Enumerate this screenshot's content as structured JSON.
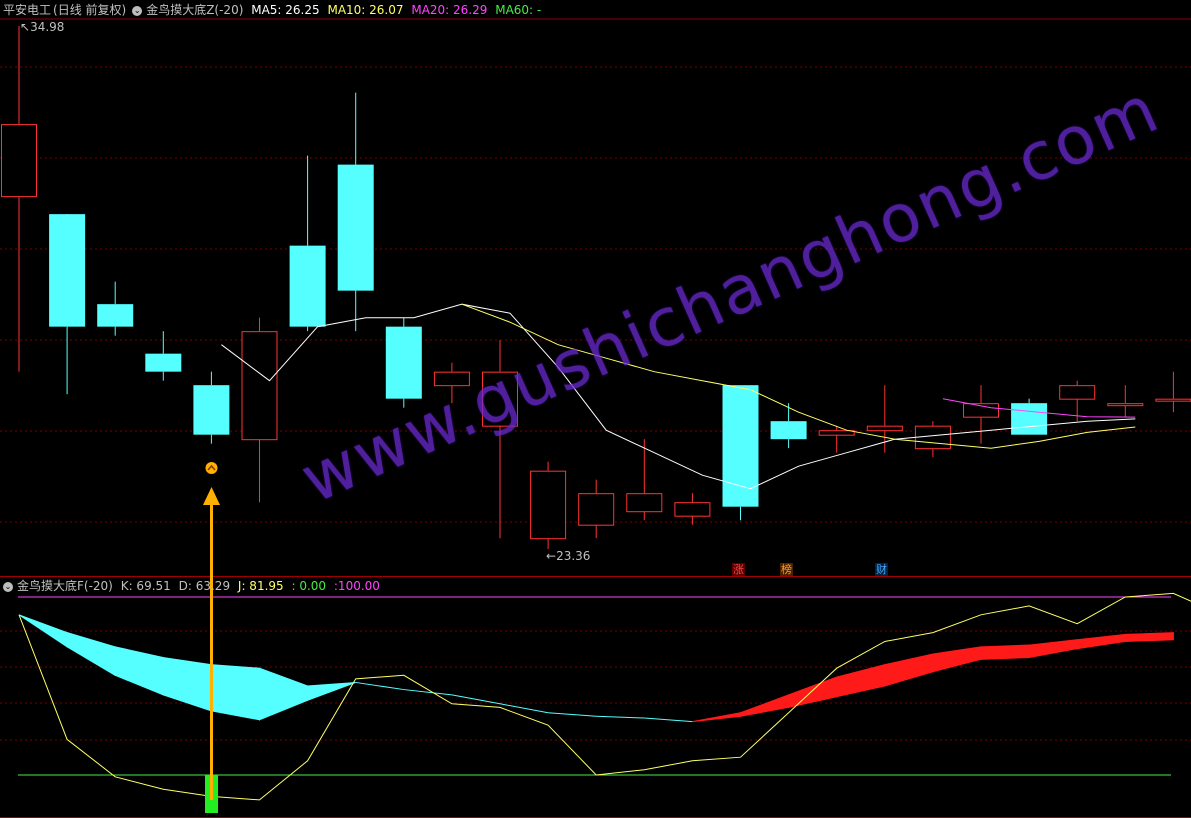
{
  "main_panel": {
    "stock": "平安电工",
    "period": "(日线 前复权)",
    "indicator": "金鸟摸大底Z(-20)",
    "ma": [
      {
        "label": "MA5: 26.25",
        "color": "#ffffff"
      },
      {
        "label": "MA10: 26.07",
        "color": "#ffff66"
      },
      {
        "label": "MA20: 26.29",
        "color": "#ff44ff"
      },
      {
        "label": "MA60: -",
        "color": "#44ee44"
      }
    ],
    "high_label": "34.98",
    "low_label": "23.36",
    "badges": [
      {
        "text": "涨",
        "color": "#ff4444",
        "bg": "#5a0000"
      },
      {
        "text": "榜",
        "color": "#ff9a30",
        "bg": "#4a2200"
      },
      {
        "text": "财",
        "color": "#44aaff",
        "bg": "#002244"
      }
    ]
  },
  "sub_panel": {
    "indicator": "金鸟摸大底F(-20)",
    "values": [
      {
        "label": "K: 69.51",
        "color": "#c0c0c0"
      },
      {
        "label": "D: 63.29",
        "color": "#c0c0c0"
      },
      {
        "label": "J: 81.95",
        "color": "#ffff66"
      },
      {
        "label": ": 0.00",
        "color": "#44ee44"
      },
      {
        "label": ":100.00",
        "color": "#ff44ff"
      }
    ]
  },
  "watermark": "www.gushichanghong.com",
  "colors": {
    "up": "#ff3333",
    "down": "#55ffff",
    "grid": "#7a0000",
    "ma5": "#ffffff",
    "ma10": "#ffff66",
    "ma20": "#ff44ff",
    "zero_line": "#44ee44",
    "hundred_line": "#ff44ff",
    "arrow": "#ffb000"
  },
  "chart_data": [
    {
      "type": "candlestick",
      "series": [
        {
          "name": "MA5",
          "values": [
            null,
            null,
            null,
            null,
            27.9,
            27.1,
            28.3,
            28.5,
            28.5,
            28.8,
            28.6,
            27.4,
            26.0,
            25.5,
            25.0,
            24.7,
            25.2,
            25.5,
            25.8,
            25.9,
            26.0,
            26.1,
            26.2,
            26.25
          ]
        },
        {
          "name": "MA10",
          "values": [
            null,
            null,
            null,
            null,
            null,
            null,
            null,
            null,
            null,
            28.8,
            28.4,
            27.9,
            27.6,
            27.3,
            27.1,
            26.9,
            26.4,
            26.0,
            25.8,
            25.7,
            25.6,
            25.75,
            25.95,
            26.07
          ]
        },
        {
          "name": "MA20",
          "values": [
            null,
            null,
            null,
            null,
            null,
            null,
            null,
            null,
            null,
            null,
            null,
            null,
            null,
            null,
            null,
            null,
            null,
            null,
            null,
            26.7,
            26.5,
            26.4,
            26.3,
            26.29
          ]
        }
      ],
      "ohlc": [
        [
          31.2,
          34.98,
          27.3,
          32.8
        ],
        [
          30.8,
          29.4,
          26.8,
          28.3
        ],
        [
          28.8,
          29.3,
          28.1,
          28.3
        ],
        [
          27.7,
          28.2,
          27.1,
          27.3
        ],
        [
          27.0,
          27.3,
          25.7,
          25.9
        ],
        [
          25.8,
          28.5,
          24.4,
          28.2
        ],
        [
          30.1,
          32.1,
          28.2,
          28.3
        ],
        [
          31.9,
          33.5,
          28.2,
          29.1
        ],
        [
          28.3,
          28.5,
          26.5,
          26.7
        ],
        [
          27.0,
          27.5,
          26.6,
          27.3
        ],
        [
          26.1,
          28.0,
          23.6,
          27.3
        ],
        [
          23.6,
          25.3,
          23.36,
          25.1
        ],
        [
          23.9,
          24.9,
          23.6,
          24.6
        ],
        [
          24.2,
          25.8,
          24.0,
          24.6
        ],
        [
          24.1,
          24.6,
          23.9,
          24.4
        ],
        [
          27.0,
          27.0,
          24.0,
          24.3
        ],
        [
          26.2,
          26.6,
          25.6,
          25.8
        ],
        [
          25.9,
          26.1,
          25.5,
          26.0
        ],
        [
          26.0,
          27.0,
          25.5,
          26.1
        ],
        [
          25.6,
          26.2,
          25.4,
          26.1
        ],
        [
          26.3,
          27.0,
          25.7,
          26.6
        ],
        [
          26.6,
          26.7,
          25.9,
          25.9
        ],
        [
          26.7,
          27.1,
          26.2,
          27.0
        ],
        [
          26.6,
          27.0,
          26.3,
          26.6
        ],
        [
          26.7,
          27.3,
          26.4,
          26.7
        ]
      ]
    },
    {
      "type": "area",
      "series": [
        {
          "name": "K",
          "values": [
            90,
            72,
            56,
            45,
            36,
            31,
            42,
            52,
            48,
            45,
            40,
            35,
            33,
            32,
            30,
            35,
            45,
            55,
            62,
            68,
            72,
            73,
            76,
            79,
            80
          ]
        },
        {
          "name": "D",
          "values": [
            90,
            80,
            72,
            66,
            62,
            60,
            50,
            52,
            48,
            45,
            40,
            35,
            33,
            32,
            30,
            33,
            38,
            44,
            50,
            58,
            65,
            66,
            71,
            75,
            76
          ]
        },
        {
          "name": "J",
          "values": [
            90,
            20,
            -1,
            -8,
            -12,
            -14,
            8,
            54,
            56,
            40,
            38,
            28,
            0,
            3,
            8,
            10,
            35,
            60,
            75,
            80,
            90,
            95,
            85,
            100,
            102,
            90
          ]
        }
      ]
    }
  ]
}
